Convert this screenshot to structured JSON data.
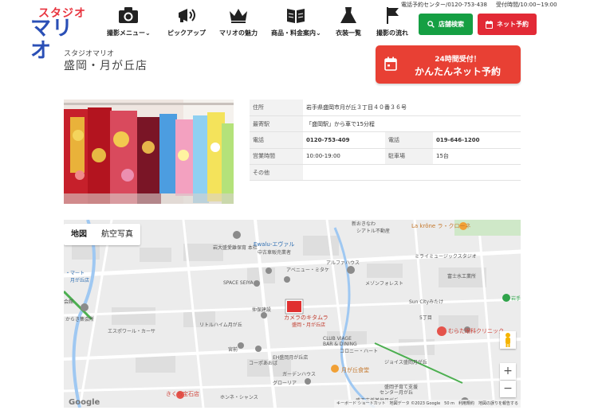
{
  "header": {
    "logo_top": "スタジオ",
    "logo_main": "マリオ",
    "nav": [
      {
        "label": "撮影メニュー⌄",
        "icon": "camera-icon"
      },
      {
        "label": "ピックアップ",
        "icon": "megaphone-icon"
      },
      {
        "label": "マリオの魅力",
        "icon": "crown-icon"
      },
      {
        "label": "商品・料金案内⌄",
        "icon": "book-icon"
      },
      {
        "label": "衣装一覧",
        "icon": "dress-icon"
      },
      {
        "label": "撮影の流れ",
        "icon": "flag-icon"
      }
    ],
    "contact_phone": "電話予約センター/0120-753-438",
    "contact_hours": "受付時間/10:00~19:00",
    "store_search_label": "店舗検索",
    "net_reserve_label": "ネット予約",
    "green": "#159f43",
    "red": "#e22a36"
  },
  "store": {
    "subtitle": "スタジオマリオ",
    "title": "盛岡・月が丘店"
  },
  "cta": {
    "line1": "24時間受付！",
    "line2": "かんたんネット予約",
    "color": "#e84034"
  },
  "info": {
    "address_label": "住所",
    "address": "岩手県盛岡市月が丘３丁目４０番３６号",
    "station_label": "最寄駅",
    "station": "「盛岡駅」から車で15分程",
    "phone_label": "電話",
    "phone": "0120-753-409",
    "phone2_label": "電話",
    "phone2": "019-646-1200",
    "hours_label": "営業時間",
    "hours": "10:00-19:00",
    "parking_label": "駐車場",
    "parking": "15台",
    "other_label": "その他",
    "other": ""
  },
  "map": {
    "tab_map": "地図",
    "tab_satellite": "航空写真",
    "zoom_in": "+",
    "zoom_out": "−",
    "google": "Google",
    "attribution": "キーボード ショートカット　地図データ ©2023 Google　50 m　利用規約　地図の誤りを報告する",
    "labels": {
      "hoikuen": "岩大盛愛離保育 本社",
      "ewalu": "Ewalu-エヴァル",
      "ewalu_sub": "中古車販売業者",
      "shinkin": "新おきなわ",
      "shinkin_sub": "シアトル不動産",
      "lakrone": "La krône ラ・クローネ",
      "alpha": "アルファハウス",
      "avenue": "アベニュー・ミタケ",
      "mirai": "ミライミュージックスタジオ",
      "fuji": "富士水工業所",
      "maison": "メゾンフォレスト",
      "seiya": "SPACE SEIYA",
      "sunciti": "Sun Cityみたけ",
      "iwate": "岩手県",
      "store": "カメラのキタムラ",
      "store_sub": "盛岡・月が丘店",
      "ise": "仲保建設",
      "little": "リトルハイム月が丘",
      "esp": "エスポワール・カーサ",
      "mart": "・マート",
      "mart_sub": "月が丘店",
      "kai": "会館",
      "kai2": "からき集会所",
      "five": "5丁目",
      "murata": "むらた眼科クリニック",
      "clubviage": "CLUB VIAGE",
      "clubviage_sub": "BAR & DINING",
      "colony": "コロニー・ハート",
      "eh": "EH盛岡月が丘店",
      "onsen": "宮前",
      "cope": "コーポあおば",
      "garden": "ガーデンハウス",
      "tsuki": "月が丘食堂",
      "joy": "ジョイス盛岡月が丘",
      "center": "盛岡子育て支援",
      "center_sub": "センター月が丘",
      "kurora": "グローリア",
      "kikuchi": "きくち宝石店",
      "homy": "ホンネ・シャンス",
      "morioka": "盛工支援基地月が丘"
    }
  }
}
